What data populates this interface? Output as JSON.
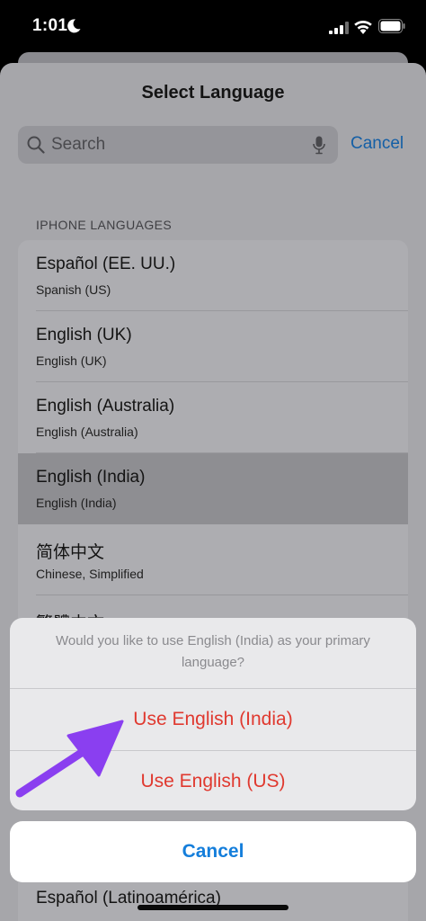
{
  "status_bar": {
    "time": "1:01"
  },
  "sheet": {
    "title": "Select Language",
    "search": {
      "placeholder": "Search",
      "cancel_label": "Cancel"
    },
    "section_header": "IPHONE LANGUAGES",
    "languages": [
      {
        "name": "Español (EE. UU.)",
        "subtitle": "Spanish (US)"
      },
      {
        "name": "English (UK)",
        "subtitle": "English (UK)"
      },
      {
        "name": "English (Australia)",
        "subtitle": "English (Australia)"
      },
      {
        "name": "English (India)",
        "subtitle": "English (India)"
      },
      {
        "name": "简体中文",
        "subtitle": "Chinese, Simplified"
      },
      {
        "name": "繁體中文",
        "subtitle": ""
      }
    ],
    "bottom_language": "Español (Latinoamérica)"
  },
  "action_sheet": {
    "message": "Would you like to use English (India) as your primary language?",
    "primary_option": "Use English (India)",
    "secondary_option": "Use English (US)",
    "cancel_label": "Cancel"
  },
  "colors": {
    "accent_blue": "#147edb",
    "destructive_red": "#e0392f",
    "annotation_purple": "#8a3ff0"
  }
}
